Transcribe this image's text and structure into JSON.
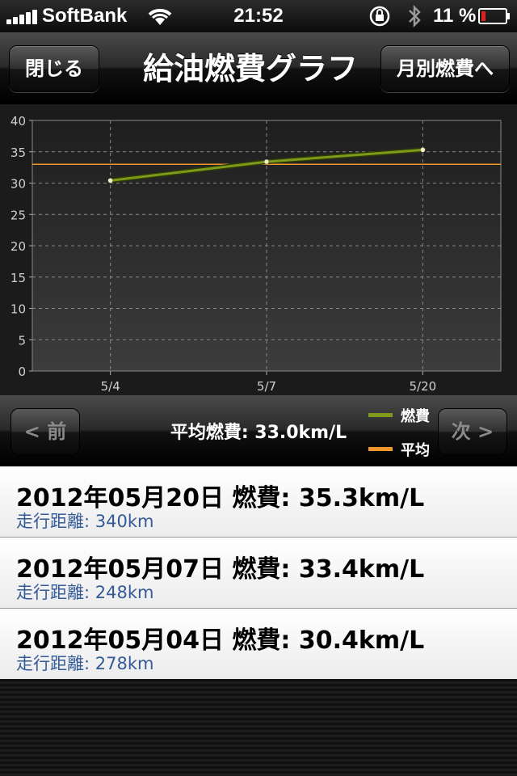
{
  "status_bar": {
    "carrier": "SoftBank",
    "time": "21:52",
    "battery_percent": "11 %",
    "icons": [
      "signal-icon",
      "wifi-icon",
      "rotation-lock-icon",
      "bluetooth-icon",
      "battery-icon"
    ]
  },
  "nav": {
    "close_label": "閉じる",
    "title": "給油燃費グラフ",
    "monthly_label": "月別燃費へ"
  },
  "chart_data": {
    "type": "line",
    "categories": [
      "5/4",
      "5/7",
      "5/20"
    ],
    "series": [
      {
        "name": "燃費",
        "values": [
          30.4,
          33.4,
          35.3
        ],
        "color": "#7d9a1a"
      },
      {
        "name": "平均",
        "values": [
          33.0,
          33.0,
          33.0
        ],
        "color": "#f0962a"
      }
    ],
    "ylim": [
      0,
      40
    ],
    "yticks": [
      "0",
      "5",
      "10",
      "15",
      "20",
      "25",
      "30",
      "35",
      "40"
    ],
    "grid": true
  },
  "average_bar": {
    "prev_label": "< 前",
    "next_label": "次 >",
    "average_text": "平均燃費: 33.0km/L",
    "legend": [
      {
        "label": "燃費",
        "color": "#7d9a1a"
      },
      {
        "label": "平均",
        "color": "#f0962a"
      }
    ]
  },
  "records": [
    {
      "title": "2012年05月20日 燃費: 35.3km/L",
      "distance": "走行距離: 340km"
    },
    {
      "title": "2012年05月07日 燃費: 33.4km/L",
      "distance": "走行距離: 248km"
    },
    {
      "title": "2012年05月04日 燃費: 30.4km/L",
      "distance": "走行距離: 278km"
    }
  ]
}
